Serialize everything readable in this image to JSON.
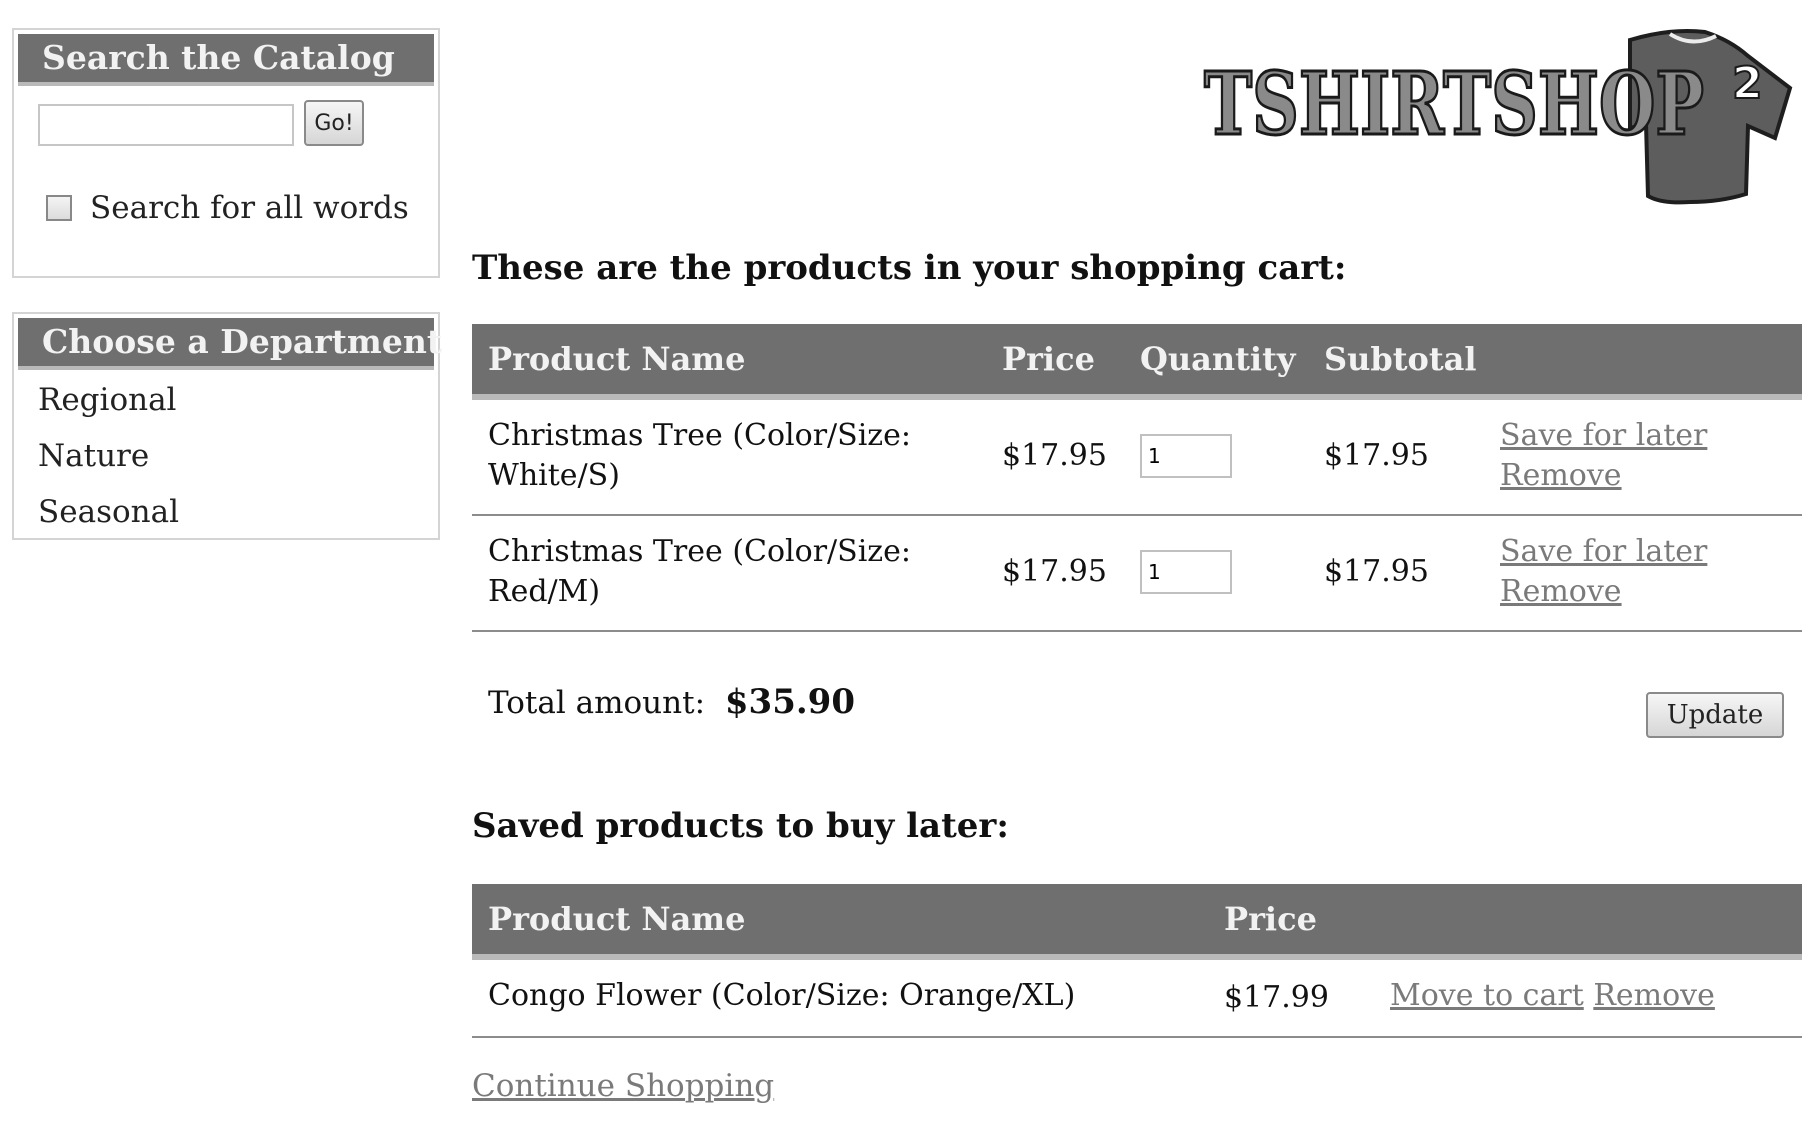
{
  "sidebar": {
    "search": {
      "title": "Search the Catalog",
      "input_value": "",
      "go_label": "Go!",
      "all_words_label": "Search for all words",
      "all_words_checked": false
    },
    "departments": {
      "title": "Choose a Department",
      "items": [
        "Regional",
        "Nature",
        "Seasonal"
      ]
    }
  },
  "logo": {
    "text": "TSHIRTSHOP",
    "superscript": "2"
  },
  "cart": {
    "heading": "These are the products in your shopping cart:",
    "columns": [
      "Product Name",
      "Price",
      "Quantity",
      "Subtotal"
    ],
    "rows": [
      {
        "name_line1": "Christmas Tree (Color/Size:",
        "name_line2": "White/S)",
        "price": "$17.95",
        "quantity": "1",
        "subtotal": "$17.95",
        "save_label": "Save for later",
        "remove_label": "Remove"
      },
      {
        "name_line1": "Christmas Tree (Color/Size:",
        "name_line2": "Red/M)",
        "price": "$17.95",
        "quantity": "1",
        "subtotal": "$17.95",
        "save_label": "Save for later",
        "remove_label": "Remove"
      }
    ],
    "total_label": "Total amount:",
    "total_value": "$35.90",
    "update_label": "Update"
  },
  "saved": {
    "heading": "Saved products to buy later:",
    "columns": [
      "Product Name",
      "Price"
    ],
    "rows": [
      {
        "name": "Congo Flower (Color/Size: Orange/XL)",
        "price": "$17.99",
        "move_label": "Move to cart",
        "remove_label": "Remove"
      }
    ]
  },
  "continue_label": "Continue Shopping",
  "colors": {
    "header_bg": "#6f6f6f",
    "header_text": "#f2f2f2",
    "link": "#7a7a7a"
  }
}
